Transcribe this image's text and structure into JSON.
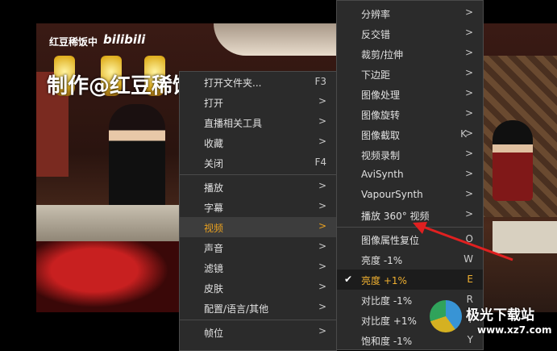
{
  "video": {
    "watermark_channel": "红豆稀饭中",
    "watermark_logo": "bilibili",
    "watermark_caption": "制作@红豆稀饭"
  },
  "left_menu": [
    {
      "label": "打开文件夹...",
      "shortcut": "F3"
    },
    {
      "label": "打开",
      "submenu": true
    },
    {
      "label": "直播相关工具",
      "submenu": true
    },
    {
      "label": "收藏",
      "submenu": true
    },
    {
      "label": "关闭",
      "shortcut": "F4"
    },
    {
      "separator": true
    },
    {
      "label": "播放",
      "submenu": true
    },
    {
      "label": "字幕",
      "submenu": true
    },
    {
      "label": "视频",
      "submenu": true,
      "active": true
    },
    {
      "label": "声音",
      "submenu": true
    },
    {
      "label": "滤镜",
      "submenu": true
    },
    {
      "label": "皮肤",
      "submenu": true
    },
    {
      "label": "配置/语言/其他",
      "submenu": true
    },
    {
      "separator": true
    },
    {
      "label": "帧位",
      "submenu": true
    }
  ],
  "right_menu": [
    {
      "label": "分辨率",
      "submenu": true
    },
    {
      "label": "反交错",
      "submenu": true
    },
    {
      "label": "裁剪/拉伸",
      "submenu": true
    },
    {
      "label": "下边距",
      "submenu": true
    },
    {
      "label": "图像处理",
      "submenu": true
    },
    {
      "label": "图像旋转",
      "submenu": true
    },
    {
      "label": "图像截取",
      "shortcut": "K",
      "submenu": true
    },
    {
      "label": "视频录制",
      "submenu": true
    },
    {
      "label": "AviSynth",
      "submenu": true
    },
    {
      "label": "VapourSynth",
      "submenu": true
    },
    {
      "label": "播放 360° 视频",
      "submenu": true
    },
    {
      "separator": true
    },
    {
      "label": "图像属性复位",
      "shortcut": "O"
    },
    {
      "label": "亮度 -1%",
      "shortcut": "W"
    },
    {
      "label": "亮度 +1%",
      "shortcut": "E",
      "checked": true
    },
    {
      "label": "对比度 -1%",
      "shortcut": "R"
    },
    {
      "label": "对比度 +1%",
      "shortcut": "T"
    },
    {
      "label": "饱和度 -1%",
      "shortcut": "Y"
    }
  ],
  "arrow_glyph": ">",
  "check_glyph": "✔",
  "site": {
    "name": "极光下载站",
    "url": "www.xz7.com"
  },
  "colors": {
    "menu_bg": "#2b2b2b",
    "highlight": "#e8a020",
    "annotation": "#e02020"
  }
}
